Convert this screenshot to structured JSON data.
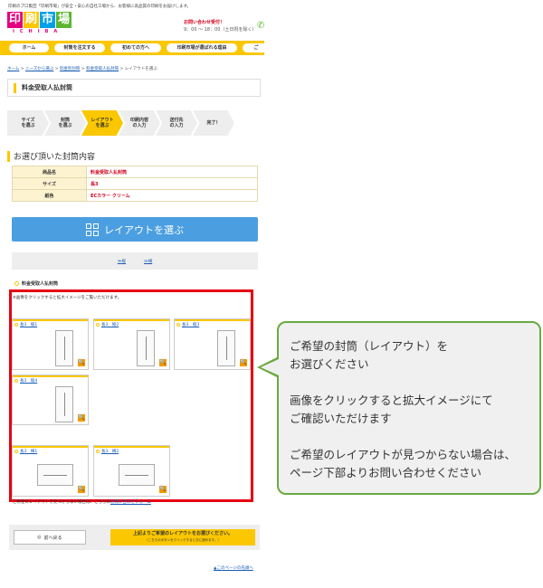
{
  "header": {
    "tagline": "印刷のプロ集団「印刷市場」が安全・安心の自社工場から、お客様に高品質の印刷をお届けします。",
    "logo": {
      "main": [
        "印",
        "刷",
        "市",
        "場"
      ],
      "sub": "ICHIBA",
      "colors": [
        "#e4007f",
        "#fac700",
        "#00a0e9",
        "#5cb531"
      ]
    },
    "contact_label": "お問い合わせ受付！",
    "contact_hours": "9：00 ～ 18：00（土日祝を除く）"
  },
  "nav": [
    {
      "label": "ホーム"
    },
    {
      "label": "封筒を注文する"
    },
    {
      "label": "初めての方へ"
    },
    {
      "label": "印刷市場が選ばれる理由"
    },
    {
      "label": "ご"
    }
  ],
  "breadcrumb": {
    "items": [
      "ホーム",
      "ニーズから選ぶ",
      "料金別封筒",
      "料金受取人払封筒"
    ],
    "separator": " > ",
    "current": "レイアウトを選ぶ"
  },
  "page_title": "料金受取人払封筒",
  "steps": [
    {
      "l1": "サイズ",
      "l2": "を選ぶ"
    },
    {
      "l1": "封筒",
      "l2": "を選ぶ"
    },
    {
      "l1": "レイアウト",
      "l2": "を選ぶ"
    },
    {
      "l1": "印刷内容",
      "l2": "の入力"
    },
    {
      "l1": "送付先",
      "l2": "の入力"
    },
    {
      "l1": "完了！",
      "l2": ""
    }
  ],
  "selection": {
    "heading": "お選び頂いた封筒内容",
    "rows": [
      {
        "label": "商品名",
        "value": "料金受取人払封筒"
      },
      {
        "label": "サイズ",
        "value": "長3"
      },
      {
        "label": "紙色",
        "value": "ECカラー クリーム"
      }
    ]
  },
  "layout_button": "レイアウトを選ぶ",
  "layout_links": [
    "≫縦",
    "≫横"
  ],
  "envelope_section": {
    "heading": "料金受取人払封筒",
    "click_note": "※画像をクリックすると拡大イメージをご覧いただけます。",
    "thumbs": [
      {
        "label": "長3　縦1"
      },
      {
        "label": "長3　縦2"
      },
      {
        "label": "長3　縦3"
      },
      {
        "label": "長3　縦4"
      },
      {
        "label": "長3　横1"
      },
      {
        "label": "長3　横2"
      }
    ],
    "zoom_glyph": "🔍"
  },
  "notfound": {
    "text": "ご希望のレイアウトが見つからない場合は、こちらの",
    "link": "お問い合わせフォーム"
  },
  "footer": {
    "back": "前へ戻る",
    "notice_main": "上記よりご希望のレイアウトをお選びください。",
    "notice_sub": "（こちらのボタンをクリックすると次に進めます。）"
  },
  "page_top": "▲このページの先頭へ",
  "callout": {
    "p1_line1": "ご希望の封筒（レイアウト）を",
    "p1_line2": "お選びください",
    "p2_line1": "画像をクリックすると拡大イメージにて",
    "p2_line2": "ご確認いただけます",
    "p3_line1": "ご希望のレイアウトが見つからない場合は、",
    "p3_line2": "ページ下部よりお問い合わせください"
  },
  "colors": {
    "accent": "#fac700",
    "button_blue": "#4b9fe1",
    "highlight_red": "#e60012",
    "callout_border": "#6aaa41",
    "value_red": "#d0021b"
  }
}
